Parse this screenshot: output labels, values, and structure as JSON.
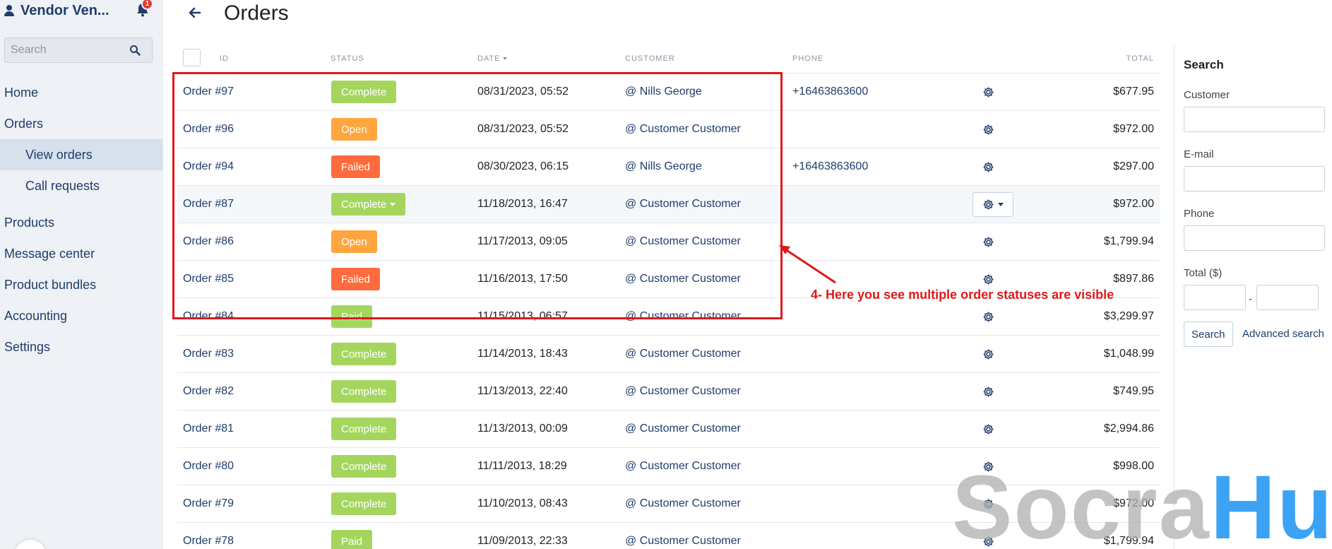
{
  "sidebar": {
    "brand": "Vendor Ven...",
    "notification_count": "1",
    "search_placeholder": "Search",
    "nav": [
      {
        "label": "Home"
      },
      {
        "label": "Orders"
      },
      {
        "label": "View orders"
      },
      {
        "label": "Call requests"
      },
      {
        "label": "Products"
      },
      {
        "label": "Message center"
      },
      {
        "label": "Product bundles"
      },
      {
        "label": "Accounting"
      },
      {
        "label": "Settings"
      }
    ]
  },
  "header": {
    "title": "Orders"
  },
  "table": {
    "columns": {
      "id": "ID",
      "status": "STATUS",
      "date": "DATE",
      "customer": "CUSTOMER",
      "phone": "PHONE",
      "total": "TOTAL"
    },
    "rows": [
      {
        "id": "Order #97",
        "status": "Complete",
        "date": "08/31/2023, 05:52",
        "customer": "@ Nills George",
        "phone": "+16463863600",
        "total": "$677.95"
      },
      {
        "id": "Order #96",
        "status": "Open",
        "date": "08/31/2023, 05:52",
        "customer": "@ Customer Customer",
        "phone": "",
        "total": "$972.00"
      },
      {
        "id": "Order #94",
        "status": "Failed",
        "date": "08/30/2023, 06:15",
        "customer": "@ Nills George",
        "phone": "+16463863600",
        "total": "$297.00"
      },
      {
        "id": "Order #87",
        "status": "Complete",
        "date": "11/18/2013, 16:47",
        "customer": "@ Customer Customer",
        "phone": "",
        "total": "$972.00"
      },
      {
        "id": "Order #86",
        "status": "Open",
        "date": "11/17/2013, 09:05",
        "customer": "@ Customer Customer",
        "phone": "",
        "total": "$1,799.94"
      },
      {
        "id": "Order #85",
        "status": "Failed",
        "date": "11/16/2013, 17:50",
        "customer": "@ Customer Customer",
        "phone": "",
        "total": "$897.86"
      },
      {
        "id": "Order #84",
        "status": "Paid",
        "date": "11/15/2013, 06:57",
        "customer": "@ Customer Customer",
        "phone": "",
        "total": "$3,299.97"
      },
      {
        "id": "Order #83",
        "status": "Complete",
        "date": "11/14/2013, 18:43",
        "customer": "@ Customer Customer",
        "phone": "",
        "total": "$1,048.99"
      },
      {
        "id": "Order #82",
        "status": "Complete",
        "date": "11/13/2013, 22:40",
        "customer": "@ Customer Customer",
        "phone": "",
        "total": "$749.95"
      },
      {
        "id": "Order #81",
        "status": "Complete",
        "date": "11/13/2013, 00:09",
        "customer": "@ Customer Customer",
        "phone": "",
        "total": "$2,994.86"
      },
      {
        "id": "Order #80",
        "status": "Complete",
        "date": "11/11/2013, 18:29",
        "customer": "@ Customer Customer",
        "phone": "",
        "total": "$998.00"
      },
      {
        "id": "Order #79",
        "status": "Complete",
        "date": "11/10/2013, 08:43",
        "customer": "@ Customer Customer",
        "phone": "",
        "total": "$972.00"
      },
      {
        "id": "Order #78",
        "status": "Paid",
        "date": "11/09/2013, 22:33",
        "customer": "@ Customer Customer",
        "phone": "",
        "total": "$1,799.94"
      }
    ]
  },
  "status_colors": {
    "Complete": "#a4d65e",
    "Open": "#ffa640",
    "Failed": "#ff6b3d",
    "Paid": "#a4d65e"
  },
  "filter": {
    "title": "Search",
    "customer_label": "Customer",
    "email_label": "E-mail",
    "phone_label": "Phone",
    "total_label": "Total ($)",
    "range_separator": "-",
    "search_button": "Search",
    "advanced_link": "Advanced search"
  },
  "annotation": {
    "text": "4- Here you see multiple order statuses are visible"
  },
  "watermark": {
    "part1": "Socra",
    "part2": "Hub"
  }
}
